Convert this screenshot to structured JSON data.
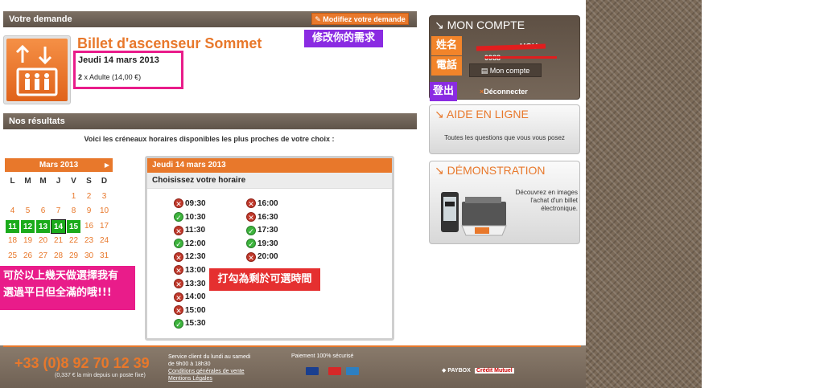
{
  "demande": {
    "bar_title": "Votre demande",
    "modify_btn": "Modifiez votre demande",
    "annot_modify": "修改你的需求",
    "product_title": "Billet d'ascenseur Sommet",
    "date": "Jeudi 14 mars 2013",
    "qty_prefix": "2",
    "qty_text": "x Adulte (14,00 €)"
  },
  "resultats": {
    "bar_title": "Nos résultats",
    "subtitle": "Voici les créneaux horaires disponibles les plus proches de votre choix :"
  },
  "calendar": {
    "month": "Mars 2013",
    "next_icon": "chevron-right-icon",
    "day_names": [
      "L",
      "M",
      "M",
      "J",
      "V",
      "S",
      "D"
    ],
    "weeks": [
      [
        "",
        "",
        "",
        "",
        "1",
        "2",
        "3"
      ],
      [
        "4",
        "5",
        "6",
        "7",
        "8",
        "9",
        "10"
      ],
      [
        "11",
        "12",
        "13",
        "14",
        "15",
        "16",
        "17"
      ],
      [
        "18",
        "19",
        "20",
        "21",
        "22",
        "23",
        "24"
      ],
      [
        "25",
        "26",
        "27",
        "28",
        "29",
        "30",
        "31"
      ]
    ],
    "available": [
      "11",
      "12",
      "13",
      "14",
      "15"
    ],
    "selected": "14"
  },
  "slots": {
    "header": "Jeudi 14 mars 2013",
    "subheader": "Choisissez votre horaire",
    "col1": [
      {
        "time": "09:30",
        "status": "full"
      },
      {
        "time": "10:30",
        "status": "available"
      },
      {
        "time": "11:30",
        "status": "full"
      },
      {
        "time": "12:00",
        "status": "available"
      },
      {
        "time": "12:30",
        "status": "full"
      },
      {
        "time": "13:00",
        "status": "full"
      },
      {
        "time": "13:30",
        "status": "full"
      },
      {
        "time": "14:00",
        "status": "full"
      },
      {
        "time": "15:00",
        "status": "full"
      },
      {
        "time": "15:30",
        "status": "available"
      }
    ],
    "col2": [
      {
        "time": "16:00",
        "status": "full"
      },
      {
        "time": "16:30",
        "status": "full"
      },
      {
        "time": "17:30",
        "status": "available"
      },
      {
        "time": "19:30",
        "status": "available"
      },
      {
        "time": "20:00",
        "status": "full"
      }
    ]
  },
  "annotations": {
    "red_note": "打勾為剩於可選時間",
    "pink_note_line1": "可於以上幾天做選擇我有",
    "pink_note_line2": "選過平日但全滿的哦!!!",
    "tag_name": "姓名",
    "tag_phone": "電話",
    "tag_logout": "登出"
  },
  "account": {
    "title": "MON COMPTE",
    "name": "HOU",
    "phone": "0988",
    "btn": "Mon compte",
    "logout": "Déconnecter"
  },
  "aide": {
    "title": "AIDE EN LIGNE",
    "text": "Toutes les questions que vous vous posez"
  },
  "demo": {
    "title": "DÉMONSTRATION",
    "text": "Découvrez en images l'achat d'un billet électronique."
  },
  "footer": {
    "phone": "+33 (0)8 92 70 12 39",
    "phone_note": "(0,337 € la min depuis un poste fixe)",
    "service_line1": "Service client du lundi au samedi",
    "service_line2": "de 9h00 à 18h30",
    "link_cgv": "Conditions générales de vente",
    "link_ml": "Mentions Légales",
    "payment": "Paiement 100% sécurisé",
    "paybox": "PAYBOX",
    "credit_mutuel": "Crédit Mutuel"
  },
  "colors": {
    "accent": "#e8782b",
    "available": "#1bab1b"
  }
}
